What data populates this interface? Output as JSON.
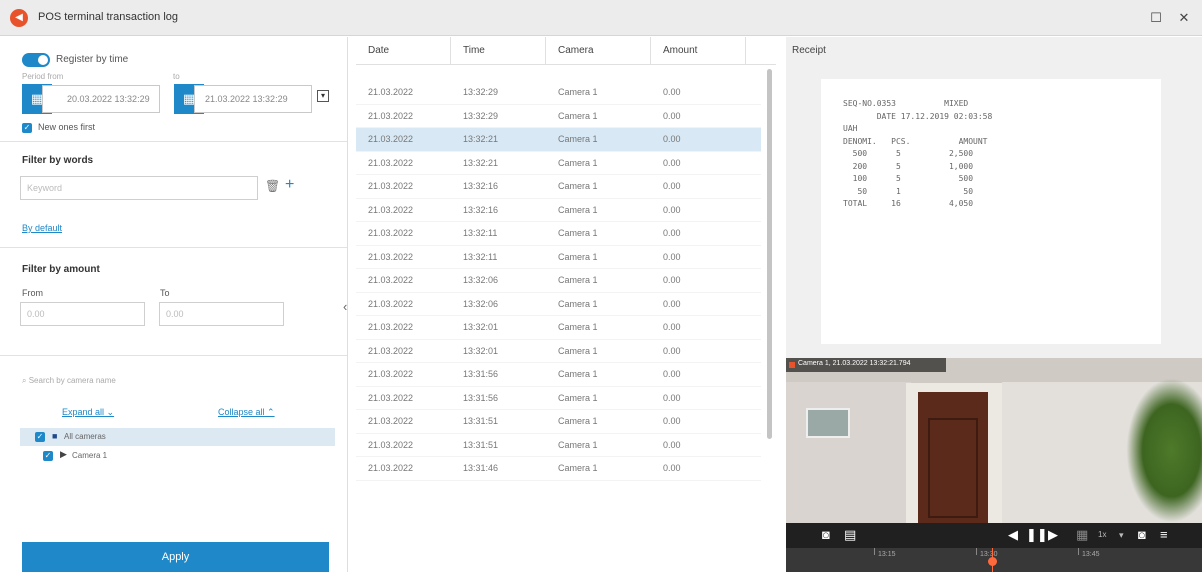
{
  "window": {
    "title": "POS terminal transaction log",
    "maximize_glyph": "☐",
    "close_glyph": "✕",
    "logo_glyph": "◀"
  },
  "filters": {
    "register_by_time_label": "Register by time",
    "period_from_label": "Period from",
    "to_label": "to",
    "date_from": "20.03.2022 13:32:29",
    "date_to": "21.03.2022 13:32:29",
    "new_ones_first_label": "New ones first",
    "filter_by_words_title": "Filter by words",
    "keyword_placeholder": "Keyword",
    "by_default_link": "By default",
    "filter_by_amount_title": "Filter by amount",
    "amount_from_label": "From",
    "amount_to_label": "To",
    "amount_from_placeholder": "0.00",
    "amount_to_placeholder": "0.00",
    "camera_search_placeholder": "Search by camera name",
    "expand_all_label": "Expand all",
    "collapse_all_label": "Collapse all",
    "tree": [
      "All cameras",
      "Camera 1"
    ],
    "apply_label": "Apply"
  },
  "table": {
    "columns": [
      "Date",
      "Time",
      "Camera",
      "Amount"
    ],
    "selected_index": 2,
    "rows": [
      {
        "date": "21.03.2022",
        "time": "13:32:29",
        "camera": "Camera 1",
        "amount": "0.00"
      },
      {
        "date": "21.03.2022",
        "time": "13:32:29",
        "camera": "Camera 1",
        "amount": "0.00"
      },
      {
        "date": "21.03.2022",
        "time": "13:32:21",
        "camera": "Camera 1",
        "amount": "0.00"
      },
      {
        "date": "21.03.2022",
        "time": "13:32:21",
        "camera": "Camera 1",
        "amount": "0.00"
      },
      {
        "date": "21.03.2022",
        "time": "13:32:16",
        "camera": "Camera 1",
        "amount": "0.00"
      },
      {
        "date": "21.03.2022",
        "time": "13:32:16",
        "camera": "Camera 1",
        "amount": "0.00"
      },
      {
        "date": "21.03.2022",
        "time": "13:32:11",
        "camera": "Camera 1",
        "amount": "0.00"
      },
      {
        "date": "21.03.2022",
        "time": "13:32:11",
        "camera": "Camera 1",
        "amount": "0.00"
      },
      {
        "date": "21.03.2022",
        "time": "13:32:06",
        "camera": "Camera 1",
        "amount": "0.00"
      },
      {
        "date": "21.03.2022",
        "time": "13:32:06",
        "camera": "Camera 1",
        "amount": "0.00"
      },
      {
        "date": "21.03.2022",
        "time": "13:32:01",
        "camera": "Camera 1",
        "amount": "0.00"
      },
      {
        "date": "21.03.2022",
        "time": "13:32:01",
        "camera": "Camera 1",
        "amount": "0.00"
      },
      {
        "date": "21.03.2022",
        "time": "13:31:56",
        "camera": "Camera 1",
        "amount": "0.00"
      },
      {
        "date": "21.03.2022",
        "time": "13:31:56",
        "camera": "Camera 1",
        "amount": "0.00"
      },
      {
        "date": "21.03.2022",
        "time": "13:31:51",
        "camera": "Camera 1",
        "amount": "0.00"
      },
      {
        "date": "21.03.2022",
        "time": "13:31:51",
        "camera": "Camera 1",
        "amount": "0.00"
      },
      {
        "date": "21.03.2022",
        "time": "13:31:46",
        "camera": "Camera 1",
        "amount": "0.00"
      }
    ]
  },
  "receipt": {
    "title": "Receipt",
    "lines": [
      "SEQ-NO.0353          MIXED",
      "       DATE 17.12.2019 02:03:58",
      "UAH",
      "DENOMI.   PCS.          AMOUNT",
      "  500      5          2,500",
      "  200      5          1,000",
      "  100      5            500",
      "   50      1             50",
      "TOTAL     16          4,050"
    ]
  },
  "video": {
    "overlay_label": "Camera 1, 21.03.2022 13:32:21.794",
    "timeline_labels": [
      "13:15",
      "13:30",
      "13:45"
    ],
    "speed_label": "1x"
  },
  "colors": {
    "accent": "#1e88c8",
    "selected_row": "#d8e9f5",
    "brand": "#e8532c"
  }
}
